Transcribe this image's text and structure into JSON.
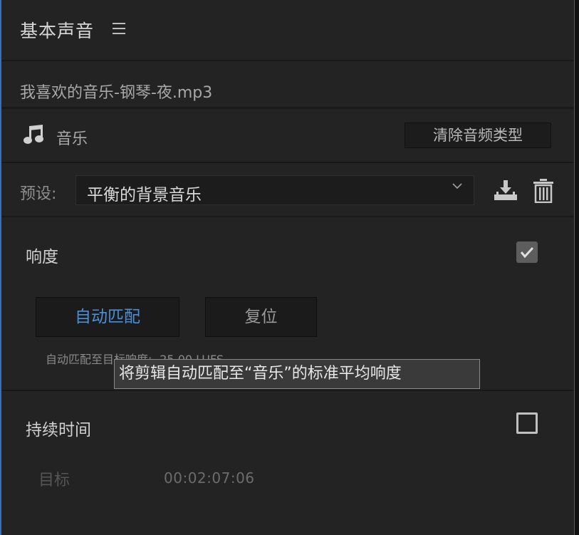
{
  "header": {
    "title": "基本声音",
    "menu_icon": "hamburger-menu-icon"
  },
  "clip": {
    "name": "我喜欢的音乐-钢琴-夜.mp3"
  },
  "audio_type": {
    "icon": "music-note-icon",
    "label": "音乐",
    "clear_button": "清除音频类型"
  },
  "preset": {
    "label": "预设:",
    "value": "平衡的背景音乐",
    "save_icon": "save-preset-icon",
    "delete_icon": "trash-icon"
  },
  "loudness": {
    "title": "响度",
    "enabled": true,
    "auto_match_button": "自动匹配",
    "reset_button": "复位",
    "target_text": "自动匹配至目标响度: -25.00 LUFS",
    "tooltip": "将剪辑自动匹配至“音乐”的标准平均响度"
  },
  "duration": {
    "title": "持续时间",
    "enabled": false,
    "target_label": "目标",
    "target_value": "00:02:07:06"
  },
  "colors": {
    "background": "#232323",
    "accent_blue": "#4a8fd8",
    "panel_border": "#3a6fb5"
  }
}
